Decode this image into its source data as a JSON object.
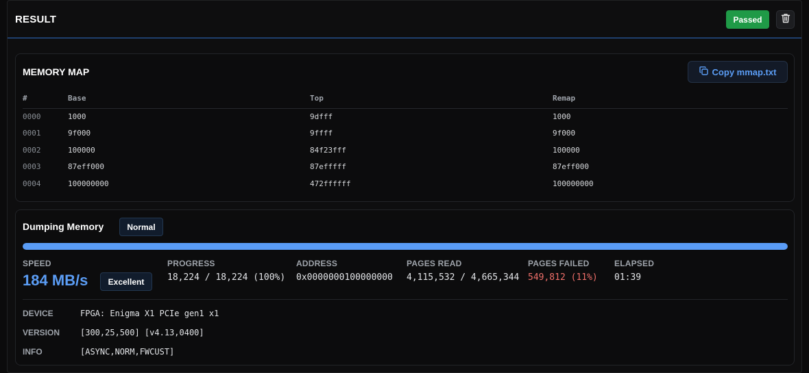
{
  "result": {
    "title": "RESULT",
    "status_badge": "Passed",
    "delete_icon": "trash-icon"
  },
  "memory_map": {
    "title": "MEMORY MAP",
    "copy_button_label": "Copy mmap.txt",
    "copy_icon": "copy-icon",
    "columns": [
      "#",
      "Base",
      "Top",
      "Remap"
    ],
    "rows": [
      [
        "0000",
        "1000",
        "9dfff",
        "1000"
      ],
      [
        "0001",
        "9f000",
        "9ffff",
        "9f000"
      ],
      [
        "0002",
        "100000",
        "84f23fff",
        "100000"
      ],
      [
        "0003",
        "87eff000",
        "87efffff",
        "87eff000"
      ],
      [
        "0004",
        "100000000",
        "472ffffff",
        "100000000"
      ]
    ]
  },
  "dump": {
    "title": "Dumping Memory",
    "mode_badge": "Normal",
    "progress_fraction": 1.0,
    "colors": {
      "accent": "#5a9cf6",
      "success": "#1f9a47",
      "failed": "#ef6f6a"
    },
    "stats": {
      "speed_label": "SPEED",
      "speed_value": "184 MB/s",
      "speed_badge": "Excellent",
      "progress_label": "PROGRESS",
      "progress_value": "18,224 / 18,224 (100%)",
      "address_label": "ADDRESS",
      "address_value": "0x0000000100000000",
      "pages_read_label": "PAGES READ",
      "pages_read_value": "4,115,532 / 4,665,344",
      "pages_failed_label": "PAGES FAILED",
      "pages_failed_value": "549,812 (11%)",
      "elapsed_label": "ELAPSED",
      "elapsed_value": "01:39"
    },
    "info": [
      {
        "label": "DEVICE",
        "value": "FPGA: Enigma X1 PCIe gen1 x1"
      },
      {
        "label": "VERSION",
        "value": "[300,25,500] [v4.13,0400]"
      },
      {
        "label": "INFO",
        "value": "[ASYNC,NORM,FWCUST]"
      }
    ]
  }
}
